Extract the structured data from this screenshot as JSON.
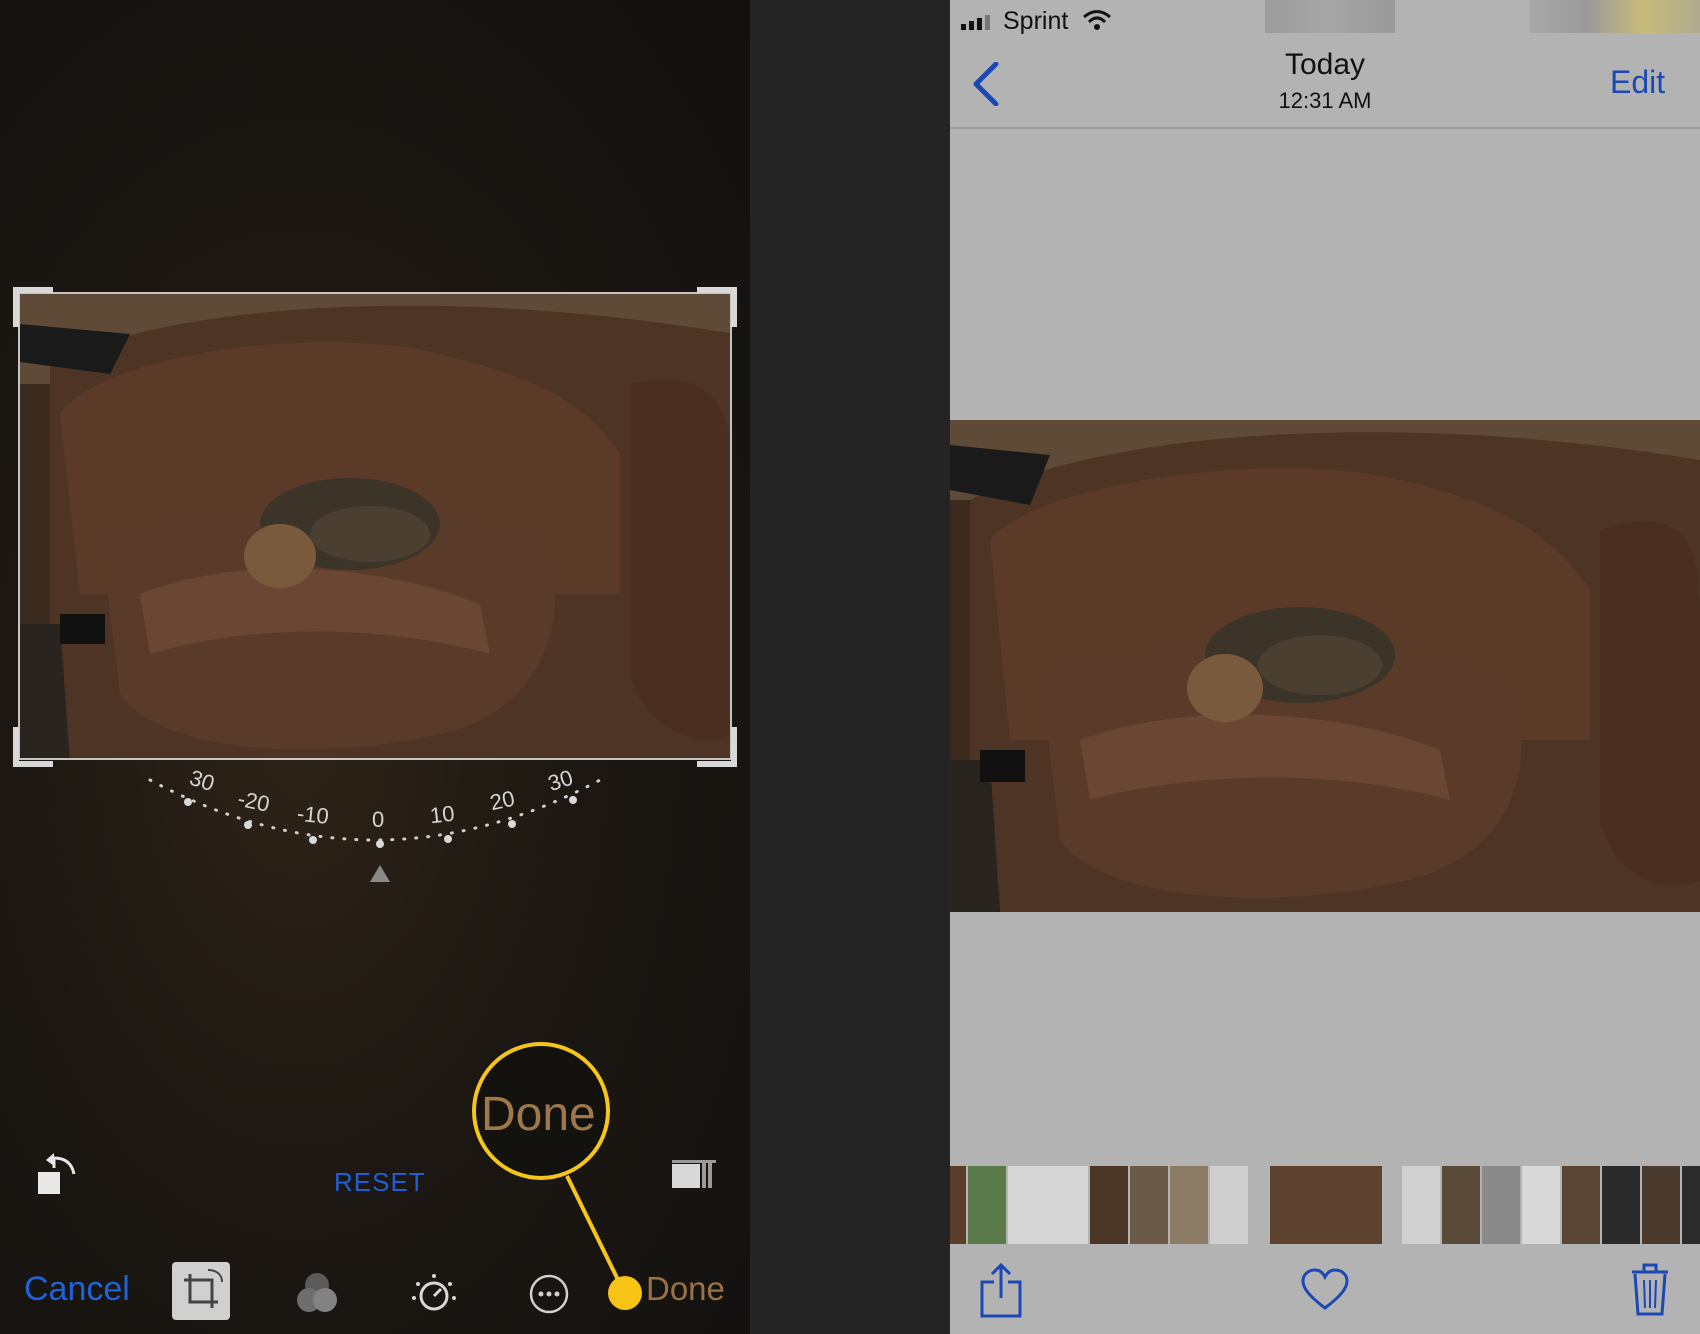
{
  "left_screen": {
    "dial": {
      "labels": [
        "30",
        "-20",
        "-10",
        "0",
        "10",
        "20",
        "30"
      ]
    },
    "toolbar": {
      "reset_label": "RESET",
      "cancel_label": "Cancel",
      "done_label": "Done",
      "done_callout_label": "Done",
      "accent_color": "#1e63d9",
      "highlight_color": "#f5c519"
    }
  },
  "right_screen": {
    "status": {
      "carrier": "Sprint"
    },
    "nav": {
      "title": "Today",
      "subtitle": "12:31 AM",
      "edit_label": "Edit"
    }
  }
}
